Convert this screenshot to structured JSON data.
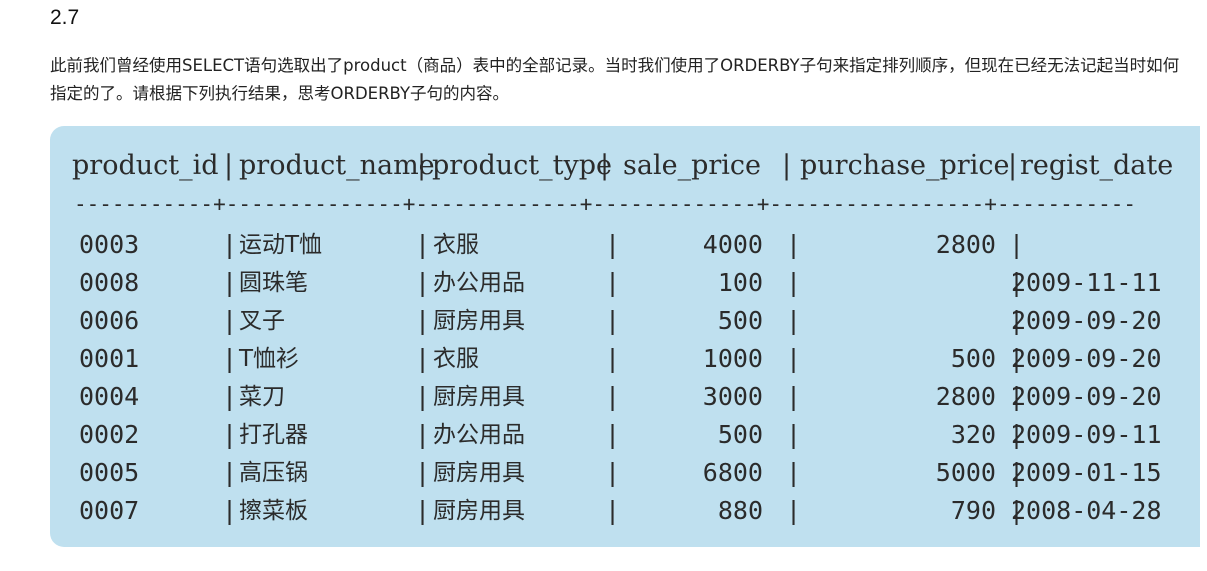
{
  "heading": "2.7",
  "description": "此前我们曾经使用SELECT语句选取出了product（商品）表中的全部记录。当时我们使用了ORDERBY子句来指定排列顺序，但现在已经无法记起当时如何指定的了。请根据下列执行结果，思考ORDERBY子句的内容。",
  "table": {
    "headers": [
      "product_id",
      "product_name",
      "product_type",
      "sale_price",
      "purchase_price",
      "regist_date"
    ],
    "separator": "-----------+--------------+-------------+-------------+-----------------+-----------",
    "rows": [
      [
        "0003",
        "运动T恤",
        "衣服",
        "4000",
        "2800",
        ""
      ],
      [
        "0008",
        "圆珠笔",
        "办公用品",
        "100",
        "",
        "2009-11-11"
      ],
      [
        "0006",
        "叉子",
        "厨房用具",
        "500",
        "",
        "2009-09-20"
      ],
      [
        "0001",
        "T恤衫",
        "衣服",
        "1000",
        "500",
        "2009-09-20"
      ],
      [
        "0004",
        "菜刀",
        "厨房用具",
        "3000",
        "2800",
        "2009-09-20"
      ],
      [
        "0002",
        "打孔器",
        "办公用品",
        "500",
        "320",
        "2009-09-11"
      ],
      [
        "0005",
        "高压锅",
        "厨房用具",
        "6800",
        "5000",
        "2009-01-15"
      ],
      [
        "0007",
        "擦菜板",
        "厨房用具",
        "880",
        "790",
        "2008-04-28"
      ]
    ]
  }
}
